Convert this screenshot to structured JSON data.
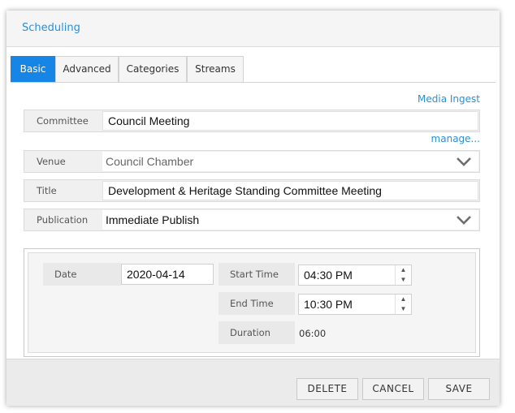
{
  "dialog": {
    "title": "Scheduling"
  },
  "tabs": [
    "Basic",
    "Advanced",
    "Categories",
    "Streams"
  ],
  "links": {
    "media_ingest": "Media Ingest",
    "manage": "manage..."
  },
  "fields": {
    "committee": {
      "label": "Committee",
      "value": "Council Meeting"
    },
    "venue": {
      "label": "Venue",
      "value": "Council Chamber"
    },
    "title": {
      "label": "Title",
      "value": "Development & Heritage Standing Committee Meeting"
    },
    "publication": {
      "label": "Publication",
      "value": "Immediate Publish"
    }
  },
  "schedule": {
    "date": {
      "label": "Date",
      "value": "2020-04-14"
    },
    "start_time": {
      "label": "Start Time",
      "value": "04:30 PM"
    },
    "end_time": {
      "label": "End Time",
      "value": "10:30 PM"
    },
    "duration": {
      "label": "Duration",
      "value": "06:00"
    }
  },
  "buttons": {
    "delete": "DELETE",
    "cancel": "CANCEL",
    "save": "SAVE"
  },
  "icons": {
    "dropdown": "chevron-down-icon",
    "spin_up": "spin-up-icon",
    "spin_down": "spin-down-icon"
  },
  "colors": {
    "accent": "#1785e6",
    "link": "#2a8fd6"
  }
}
